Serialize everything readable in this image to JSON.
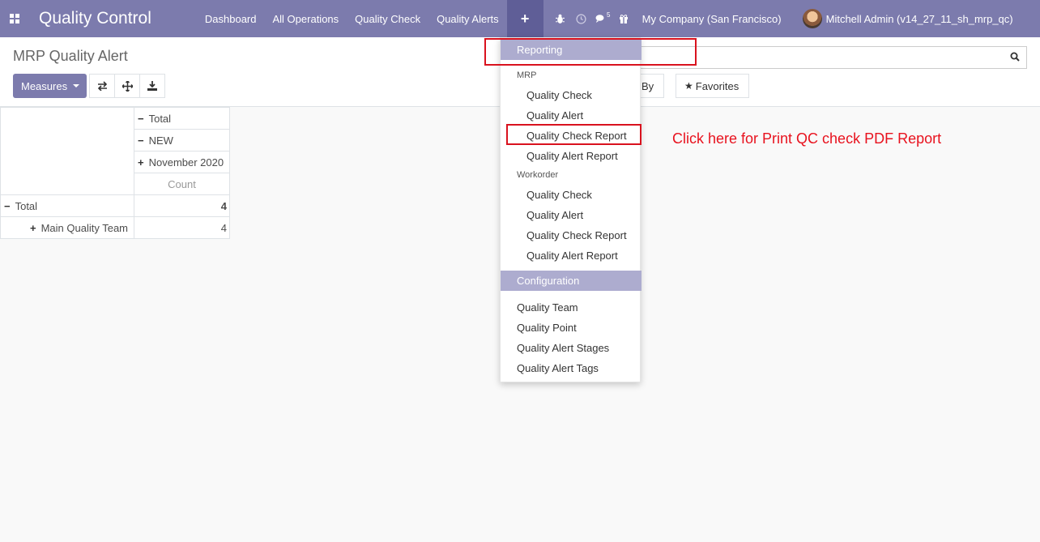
{
  "navbar": {
    "app_title": "Quality Control",
    "menu": [
      "Dashboard",
      "All Operations",
      "Quality Check",
      "Quality Alerts"
    ],
    "plus_label": "+",
    "messages_count": "5",
    "company": "My Company (San Francisco)",
    "user": "Mitchell Admin (v14_27_11_sh_mrp_qc)"
  },
  "control_panel": {
    "breadcrumb": "MRP Quality Alert",
    "measures_label": "Measures",
    "groupby_label": "By",
    "favorites_label": "Favorites"
  },
  "pivot": {
    "col_headers": [
      "Total",
      "NEW",
      "November 2020"
    ],
    "measure_header": "Count",
    "rows": [
      {
        "label": "Total",
        "value": "4"
      },
      {
        "label": "Main Quality Team",
        "value": "4"
      }
    ]
  },
  "dropdown": {
    "reporting": "Reporting",
    "mrp_group": "MRP",
    "mrp_items": [
      "Quality Check",
      "Quality Alert",
      "Quality Check Report",
      "Quality Alert Report"
    ],
    "workorder_group": "Workorder",
    "workorder_items": [
      "Quality Check",
      "Quality Alert",
      "Quality Check Report",
      "Quality Alert Report"
    ],
    "configuration": "Configuration",
    "config_items": [
      "Quality Team",
      "Quality Point",
      "Quality Alert Stages",
      "Quality Alert Tags"
    ]
  },
  "annotation": {
    "text": "Click here for Print QC check PDF Report",
    "color": "#e8121e"
  },
  "colors": {
    "primary": "#7c7bad",
    "menu_header": "#adaccf"
  }
}
